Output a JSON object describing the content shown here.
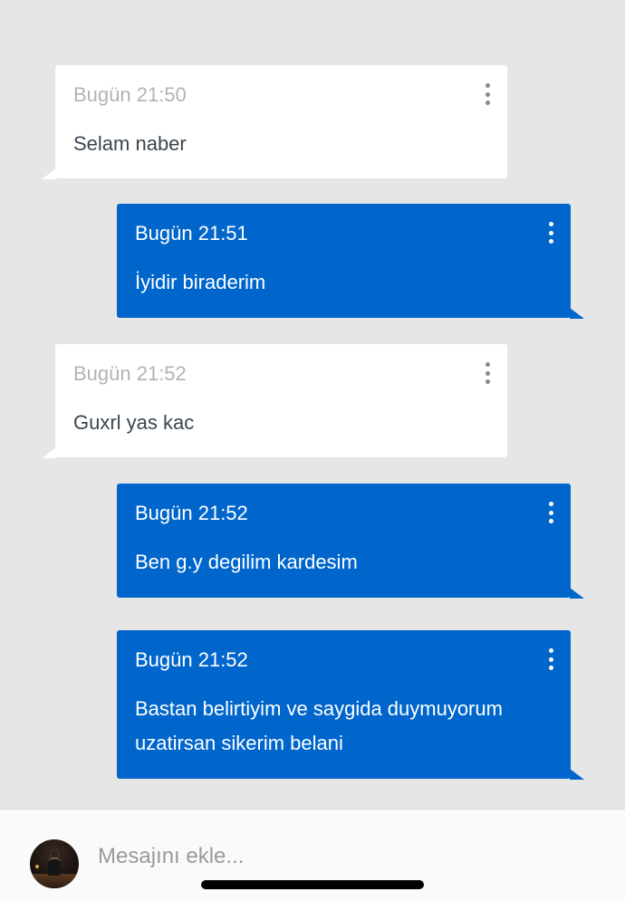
{
  "messages": [
    {
      "direction": "incoming",
      "time": "Bugün 21:50",
      "text": "Selam naber"
    },
    {
      "direction": "outgoing",
      "time": "Bugün 21:51",
      "text": "İyidir biraderim"
    },
    {
      "direction": "incoming",
      "time": "Bugün 21:52",
      "text": "Guxrl yas kac"
    },
    {
      "direction": "outgoing",
      "time": "Bugün 21:52",
      "text": "Ben g.y degilim kardesim"
    },
    {
      "direction": "outgoing",
      "time": "Bugün 21:52",
      "text": "Bastan belirtiyim ve saygida duymuyorum\nuzatirsan sikerim belani"
    }
  ],
  "composer": {
    "placeholder": "Mesajını ekle...",
    "value": ""
  },
  "icons": {
    "message_menu": "more-vertical-icon"
  },
  "colors": {
    "background": "#e6e6e6",
    "incoming_bubble": "#ffffff",
    "outgoing_bubble": "#0066cc",
    "incoming_time": "#b3b3b3",
    "incoming_text": "#3a4650"
  }
}
